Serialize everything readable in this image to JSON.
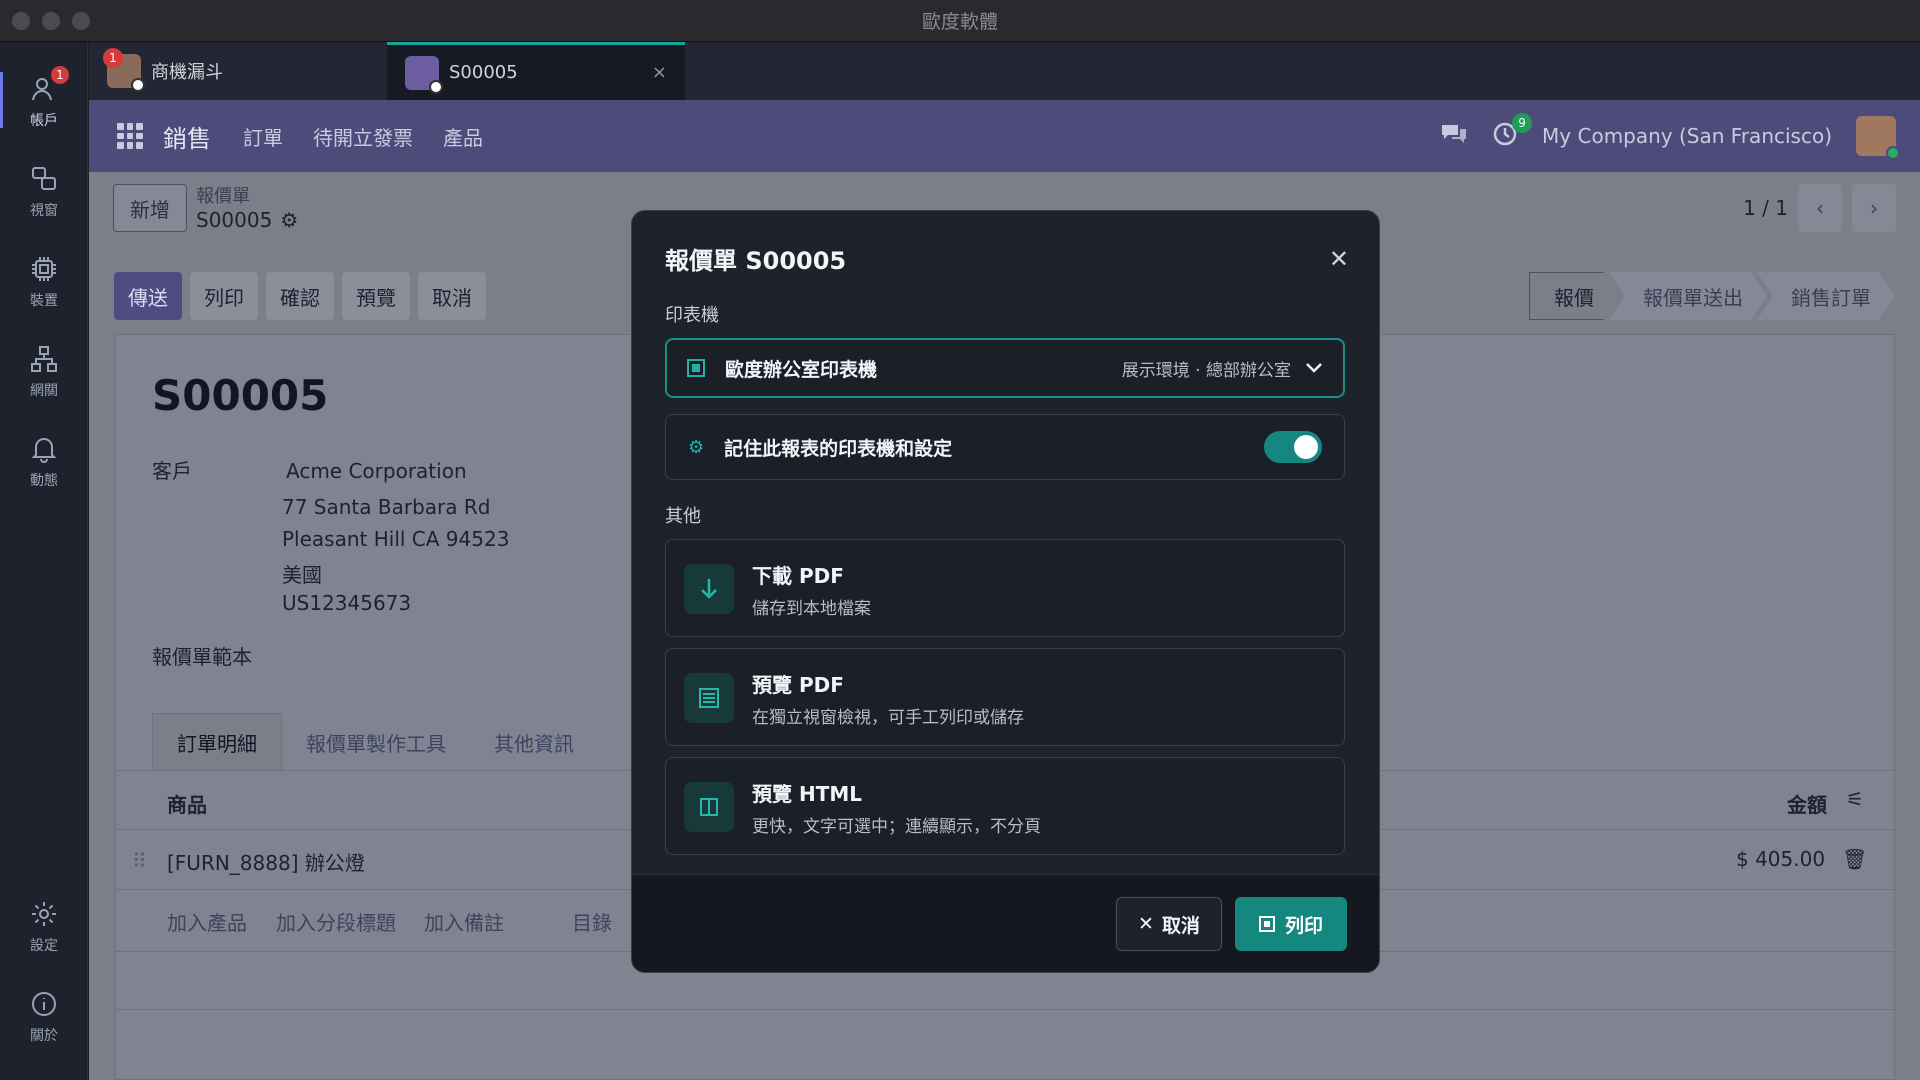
{
  "window": {
    "title": "歐度軟體"
  },
  "rail": {
    "items": [
      {
        "label": "帳戶",
        "icon": "account-icon",
        "badge": "1"
      },
      {
        "label": "視窗",
        "icon": "windows-icon"
      },
      {
        "label": "裝置",
        "icon": "chip-icon"
      },
      {
        "label": "網關",
        "icon": "network-icon"
      },
      {
        "label": "動態",
        "icon": "bell-icon"
      },
      {
        "label": "設定",
        "icon": "gear-icon"
      },
      {
        "label": "關於",
        "icon": "info-icon"
      }
    ]
  },
  "tabs": [
    {
      "label": "商機漏斗",
      "badge": "1"
    },
    {
      "label": "S00005",
      "close": "×"
    }
  ],
  "navbar": {
    "brand": "銷售",
    "menus": [
      "訂單",
      "待開立發票",
      "產品"
    ],
    "activity_badge": "9",
    "company": "My Company (San Francisco)"
  },
  "control": {
    "new_label": "新增",
    "breadcrumb_parent": "報價單",
    "breadcrumb_current": "S00005",
    "pager": "1 / 1"
  },
  "actions": [
    "傳送",
    "列印",
    "確認",
    "預覽",
    "取消"
  ],
  "status_steps": [
    "報價",
    "報價單送出",
    "銷售訂單"
  ],
  "sheet": {
    "name": "S00005",
    "customer_label": "客戶",
    "customer_name": "Acme Corporation",
    "address": [
      "77 Santa Barbara Rd",
      "Pleasant Hill CA 94523",
      "美國",
      "US12345673"
    ],
    "template_label": "報價單範本",
    "tabs": [
      "訂單明細",
      "報價單製作工具",
      "其他資訊"
    ],
    "col_product": "商品",
    "col_amount": "金額",
    "line_product": "[FURN_8888] 辦公燈",
    "line_amount": "$ 405.00",
    "add_links": [
      "加入產品",
      "加入分段標題",
      "加入備註",
      "目錄"
    ]
  },
  "modal": {
    "title": "報價單 S00005",
    "printer_section": "印表機",
    "printer_name": "歐度辦公室印表機",
    "printer_meta": "展示環境 · 總部辦公室",
    "remember_label": "記住此報表的印表機和設定",
    "remember_on": true,
    "other_section": "其他",
    "options": [
      {
        "title": "下載 PDF",
        "desc": "儲存到本地檔案",
        "icon": "download-icon"
      },
      {
        "title": "預覽 PDF",
        "desc": "在獨立視窗檢視，可手工列印或儲存",
        "icon": "document-icon"
      },
      {
        "title": "預覽 HTML",
        "desc": "更快，文字可選中；連續顯示，不分頁",
        "icon": "columns-icon"
      }
    ],
    "cancel_label": "取消",
    "print_label": "列印"
  },
  "colors": {
    "accent": "#14877f",
    "navbar": "#4e4a7a",
    "primary_action": "#4f4c84"
  }
}
